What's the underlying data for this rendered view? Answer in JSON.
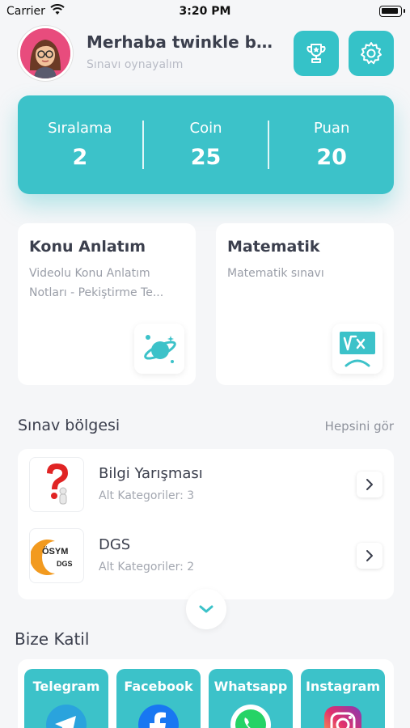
{
  "status_bar": {
    "carrier": "Carrier",
    "time": "3:20 PM"
  },
  "header": {
    "greeting": "Merhaba twinkle bari...",
    "subtitle": "Sınavı oynayalım"
  },
  "stats": [
    {
      "label": "Sıralama",
      "value": "2"
    },
    {
      "label": "Coin",
      "value": "25"
    },
    {
      "label": "Puan",
      "value": "20"
    }
  ],
  "features": [
    {
      "title": "Konu Anlatım",
      "description": "Videolu Konu Anlatım Notları - Pekiştirme Te...",
      "icon": "planet-icon"
    },
    {
      "title": "Matematik",
      "description": "Matematik sınavı",
      "icon": "math-board-icon"
    }
  ],
  "quiz_section": {
    "title": "Sınav bölgesi",
    "see_all": "Hepsini gör",
    "items": [
      {
        "title": "Bilgi Yarışması",
        "subtitle": "Alt Kategoriler: 3",
        "icon": "question-mark-icon"
      },
      {
        "title": "DGS",
        "subtitle": "Alt Kategoriler: 2",
        "icon": "osym-dgs-logo",
        "logo_text_1": "ÖSYM",
        "logo_text_2": "DGS"
      }
    ]
  },
  "join_section": {
    "title": "Bize Katil",
    "socials": [
      {
        "label": "Telegram",
        "icon": "telegram-icon"
      },
      {
        "label": "Facebook",
        "icon": "facebook-icon"
      },
      {
        "label": "Whatsapp",
        "icon": "whatsapp-icon"
      },
      {
        "label": "Instagram",
        "icon": "instagram-icon"
      }
    ]
  },
  "colors": {
    "accent": "#3cc2c9",
    "text": "#3b3f4d",
    "muted": "#9a9ea8",
    "background": "#f5f6f8"
  }
}
